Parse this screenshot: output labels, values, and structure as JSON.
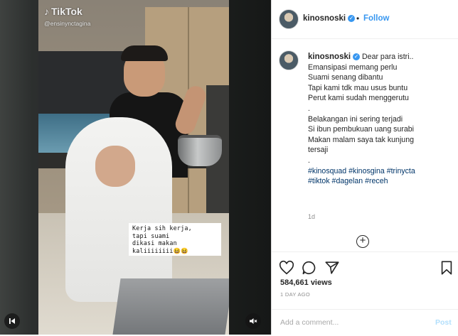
{
  "video": {
    "watermark_brand": "TikTok",
    "watermark_handle": "@ensinynctagina",
    "overlay_caption": [
      "Kerja sih kerja,",
      "tapi suami",
      "dikasi makan",
      "kaliiiiiiii😆😆"
    ]
  },
  "post": {
    "username": "kinosnoski",
    "follow_label": "Follow",
    "caption_lines": [
      "Dear para istri..",
      "Emansipasi memang perlu",
      "Suami senang dibantu",
      "Tapi kami tdk mau usus buntu",
      "Perut kami sudah menggerutu",
      ".",
      "Belakangan ini sering terjadi",
      "Si ibun pembukuan uang surabi",
      "Makan malam saya tak kunjung",
      "tersaji",
      "."
    ],
    "hashtag_lines": [
      "#kinosquad #kinosgina #trinycta",
      "#tiktok #dagelan #receh"
    ],
    "caption_age": "1d",
    "views": "584,661 views",
    "date": "1 DAY AGO",
    "comment_placeholder": "Add a comment...",
    "post_button": "Post"
  },
  "colors": {
    "link_blue": "#3897f0",
    "hashtag_blue": "#003569",
    "text": "#262626",
    "muted": "#8e8e8e"
  },
  "icons": [
    "music-note-icon",
    "verified-badge-icon",
    "plus-circle-icon",
    "heart-icon",
    "comment-icon",
    "share-icon",
    "bookmark-icon",
    "skip-back-icon",
    "mute-icon"
  ]
}
